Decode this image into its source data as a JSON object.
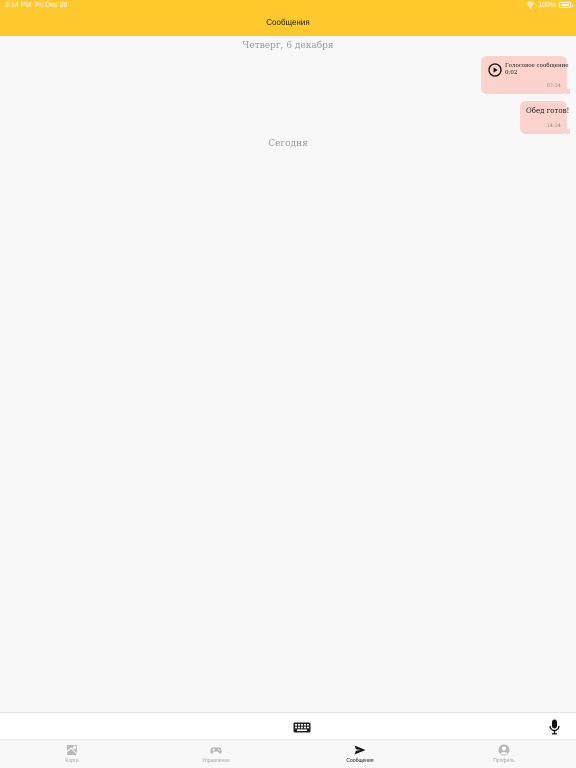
{
  "status_bar": {
    "time": "2:14 PM",
    "date": "Fri Dec 28",
    "battery": "100%"
  },
  "nav": {
    "title": "Сообщения"
  },
  "chat": {
    "separators": [
      "Четверг, 6 декабря",
      "Сегодня"
    ],
    "messages": [
      {
        "kind": "voice",
        "title": "Голосовое сообщение",
        "duration": "0:02",
        "time": "07:34",
        "icon": "play-icon"
      },
      {
        "kind": "text",
        "text": "Обед готов!",
        "time": "14:34"
      }
    ]
  },
  "input_bar": {
    "keyboard_icon": "keyboard-icon",
    "mic_icon": "microphone-icon"
  },
  "tabs": [
    {
      "label": "Карта",
      "icon": "map-icon",
      "active": false
    },
    {
      "label": "Управление",
      "icon": "gamepad-icon",
      "active": false
    },
    {
      "label": "Сообщения",
      "icon": "send-icon",
      "active": true
    },
    {
      "label": "Профиль",
      "icon": "profile-icon",
      "active": false
    }
  ],
  "colors": {
    "accent": "#ffc82c",
    "bubble": "#fcd3cc",
    "background": "#f8f8f8"
  }
}
